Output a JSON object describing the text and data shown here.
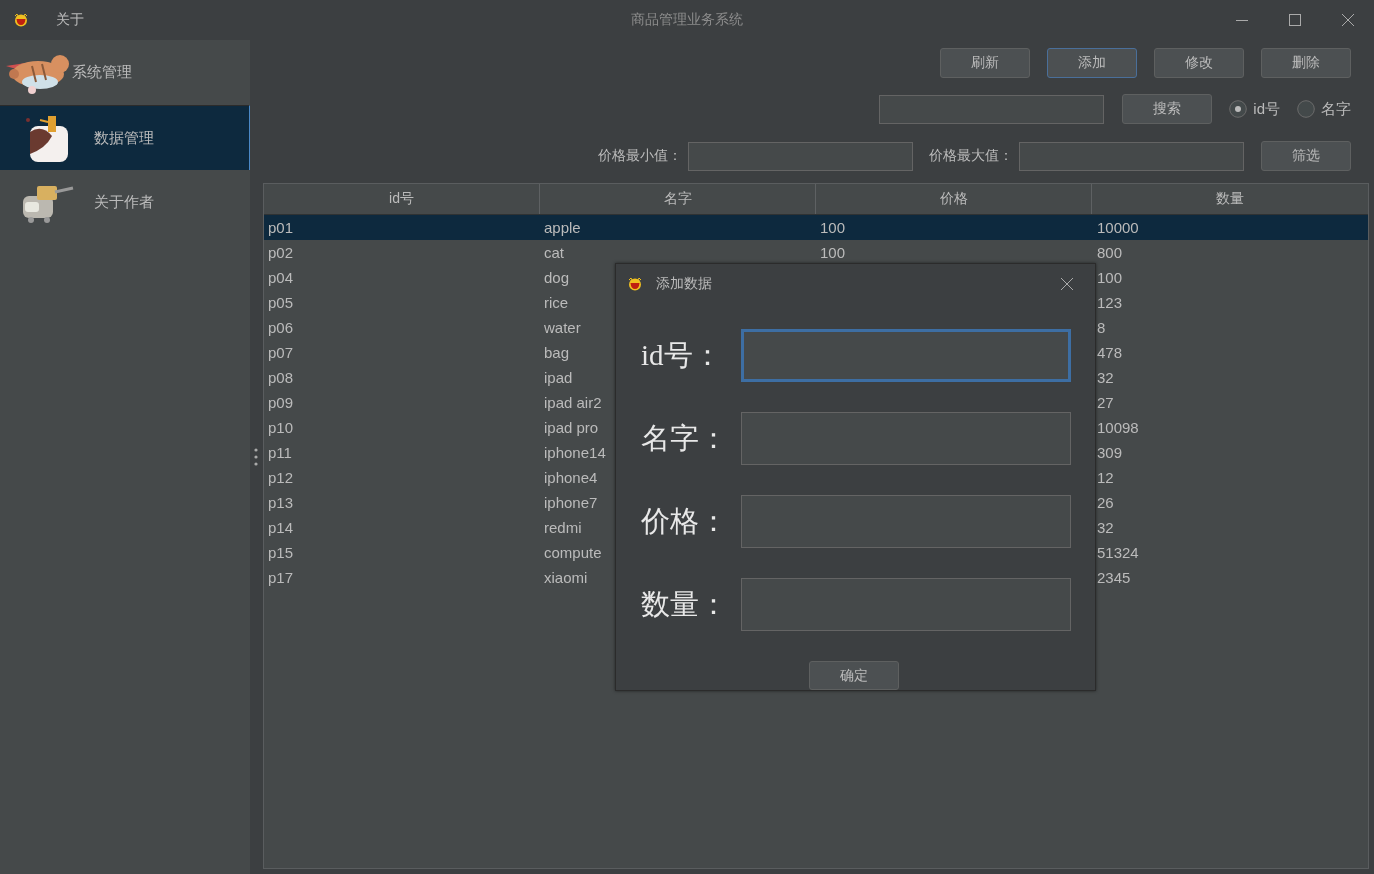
{
  "window": {
    "title": "商品管理业务系统",
    "menu": [
      "关于"
    ]
  },
  "sidebar": {
    "items": [
      {
        "label": "系统管理",
        "selected": false
      },
      {
        "label": "数据管理",
        "selected": true
      },
      {
        "label": "关于作者",
        "selected": false
      }
    ]
  },
  "toolbar": {
    "buttons": [
      {
        "label": "刷新",
        "focused": false
      },
      {
        "label": "添加",
        "focused": true
      },
      {
        "label": "修改",
        "focused": false
      },
      {
        "label": "删除",
        "focused": false
      }
    ]
  },
  "search": {
    "button": "搜索",
    "options": [
      {
        "label": "id号",
        "selected": true
      },
      {
        "label": "名字",
        "selected": false
      }
    ]
  },
  "filter": {
    "min_label": "价格最小值：",
    "max_label": "价格最大值：",
    "button": "筛选"
  },
  "table": {
    "columns": [
      "id号",
      "名字",
      "价格",
      "数量"
    ],
    "rows": [
      {
        "id": "p01",
        "name": "apple",
        "price": "100",
        "quantity": "10000",
        "selected": true
      },
      {
        "id": "p02",
        "name": "cat",
        "price": "100",
        "quantity": "800",
        "selected": false
      },
      {
        "id": "p04",
        "name": "dog",
        "quantity": "100",
        "selected": false
      },
      {
        "id": "p05",
        "name": "rice",
        "quantity": "123",
        "selected": false
      },
      {
        "id": "p06",
        "name": "water",
        "quantity": "8",
        "selected": false
      },
      {
        "id": "p07",
        "name": "bag",
        "quantity": "478",
        "selected": false
      },
      {
        "id": "p08",
        "name": "ipad",
        "quantity": "32",
        "selected": false
      },
      {
        "id": "p09",
        "name": "ipad air2",
        "quantity": "27",
        "selected": false
      },
      {
        "id": "p10",
        "name": "ipad pro",
        "quantity": "10098",
        "selected": false
      },
      {
        "id": "p11",
        "name": "iphone14",
        "quantity": "309",
        "selected": false
      },
      {
        "id": "p12",
        "name": "iphone4",
        "quantity": "12",
        "selected": false
      },
      {
        "id": "p13",
        "name": "iphone7",
        "quantity": "26",
        "selected": false
      },
      {
        "id": "p14",
        "name": "redmi",
        "quantity": "32",
        "selected": false
      },
      {
        "id": "p15",
        "name": "compute",
        "quantity": "51324",
        "selected": false
      },
      {
        "id": "p17",
        "name": "xiaomi",
        "quantity": "2345",
        "selected": false
      }
    ]
  },
  "dialog": {
    "title": "添加数据",
    "fields": [
      {
        "label": "id号：",
        "focused": true
      },
      {
        "label": "名字：",
        "focused": false
      },
      {
        "label": "价格：",
        "focused": false
      },
      {
        "label": "数量：",
        "focused": false
      }
    ],
    "button": "确定"
  }
}
